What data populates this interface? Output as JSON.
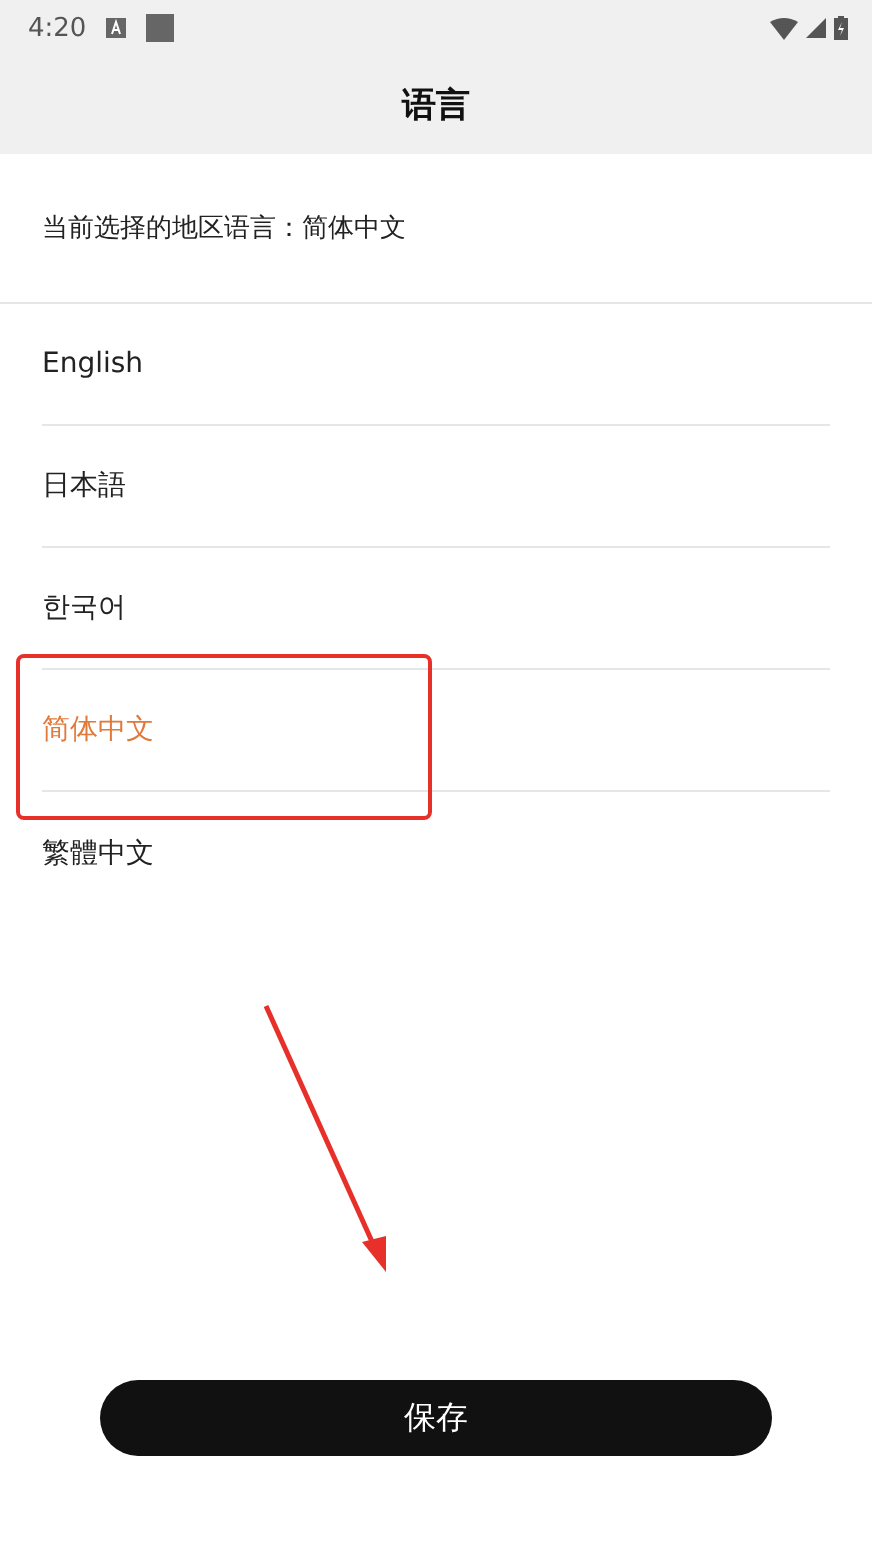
{
  "status_bar": {
    "time": "4:20"
  },
  "header": {
    "title": "语言"
  },
  "current": {
    "text": "当前选择的地区语言：简体中文"
  },
  "languages": [
    {
      "label": "English",
      "selected": false
    },
    {
      "label": "日本語",
      "selected": false
    },
    {
      "label": "한국어",
      "selected": false
    },
    {
      "label": "简体中文",
      "selected": true
    },
    {
      "label": "繁體中文",
      "selected": false
    }
  ],
  "save_button": {
    "label": "保存"
  }
}
